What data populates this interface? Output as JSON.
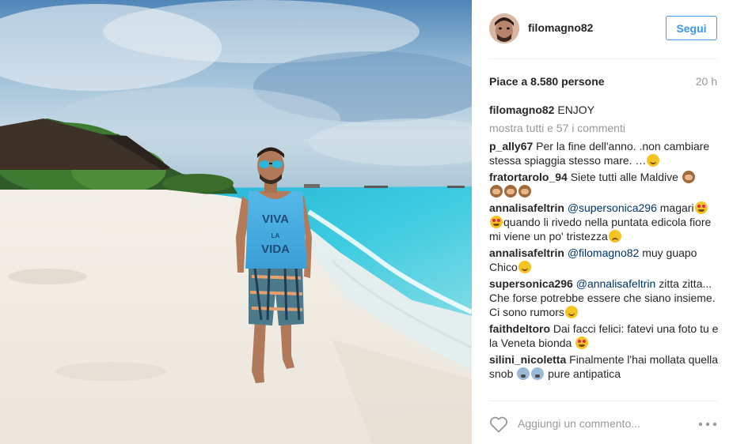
{
  "post": {
    "username": "filomagno82",
    "follow_label": "Segui",
    "likes": "Piace a 8.580 persone",
    "time": "20 h",
    "caption": {
      "user": "filomagno82",
      "text": " ENJOY"
    },
    "show_all_comments": "mostra tutti e 57 i commenti",
    "comments": [
      {
        "user": "p_ally67",
        "text": " Per la fine dell'anno. .non cambiare stessa spiaggia stesso mare. …"
      },
      {
        "user": "fratortarolo_94",
        "text": " Siete tutti alle Maldive "
      },
      {
        "user": "annalisafeltrin",
        "mention": "@supersonica296",
        "text": " magari",
        "text2": "quando li rivedo nella puntata edicola fiore mi viene un po' tristezza"
      },
      {
        "user": "annalisafeltrin",
        "mention": "@filomagno82",
        "text": " muy guapo Chico"
      },
      {
        "user": "supersonica296",
        "mention": "@annalisafeltrin",
        "text": " zitta zitta... Che forse potrebbe essere che siano insieme. Ci sono rumors"
      },
      {
        "user": "faithdeltoro",
        "text": " Dai facci felici: fatevi una foto tu e la Veneta bionda "
      },
      {
        "user": "silini_nicoletta",
        "text": " Finalmente l'hai mollata quella snob ",
        "text2": " pure antipatica"
      }
    ],
    "comment_placeholder": "Aggiungi un commento...",
    "icons": {
      "like": "heart-icon",
      "options": "more-options-icon"
    },
    "colors": {
      "follow": "#3897f0",
      "muted": "#999999",
      "mention": "#003569"
    }
  }
}
